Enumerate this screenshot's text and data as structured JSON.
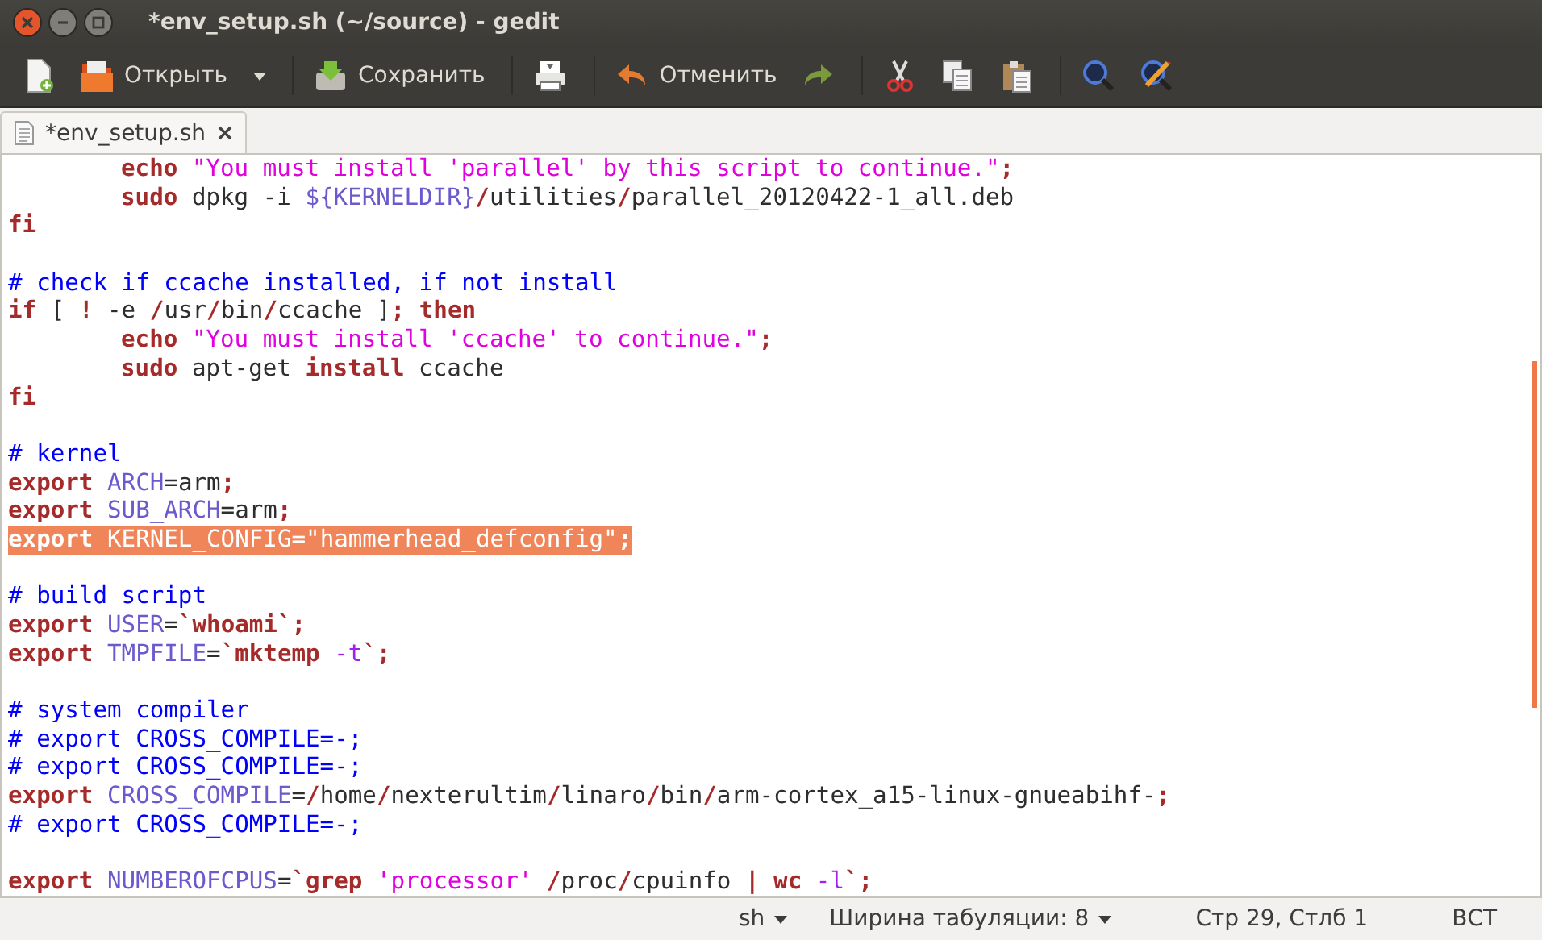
{
  "window": {
    "title": "*env_setup.sh (~/source) - gedit"
  },
  "toolbar": {
    "items": [
      {
        "kind": "new"
      },
      {
        "kind": "open",
        "label": "Открыть",
        "dropdown": true
      },
      {
        "kind": "separator"
      },
      {
        "kind": "save",
        "label": "Сохранить"
      },
      {
        "kind": "separator"
      },
      {
        "kind": "print"
      },
      {
        "kind": "separator"
      },
      {
        "kind": "undo",
        "label": "Отменить"
      },
      {
        "kind": "redo"
      },
      {
        "kind": "separator"
      },
      {
        "kind": "cut"
      },
      {
        "kind": "copy"
      },
      {
        "kind": "paste"
      },
      {
        "kind": "separator"
      },
      {
        "kind": "find"
      },
      {
        "kind": "replace"
      }
    ]
  },
  "tabs": [
    {
      "label": "*env_setup.sh",
      "selected": true
    }
  ],
  "editor": {
    "lines": [
      {
        "selected": false,
        "indent": true,
        "tokens": [
          {
            "kind": "kw",
            "text": "echo"
          },
          {
            "kind": "str",
            "text": " \"You must install 'parallel' by this script to continue.\""
          },
          {
            "kind": "op",
            "text": ";"
          }
        ]
      },
      {
        "selected": false,
        "indent": true,
        "tokens": [
          {
            "kind": "kw",
            "text": "sudo"
          },
          {
            "kind": "pl",
            "text": " dpkg -i "
          },
          {
            "kind": "var",
            "text": "${KERNELDIR}"
          },
          {
            "kind": "op",
            "text": "/"
          },
          {
            "kind": "pl",
            "text": "utilities"
          },
          {
            "kind": "op",
            "text": "/"
          },
          {
            "kind": "pl",
            "text": "parallel_20120422-1_all.deb"
          }
        ]
      },
      {
        "selected": false,
        "tokens": [
          {
            "kind": "kw",
            "text": "fi"
          }
        ]
      },
      {
        "selected": false
      },
      {
        "selected": false,
        "tokens": [
          {
            "kind": "cm",
            "text": "# check if ccache installed, if not install"
          }
        ]
      },
      {
        "selected": false,
        "tokens": [
          {
            "kind": "kw",
            "text": "if"
          },
          {
            "kind": "pl",
            "text": " [ "
          },
          {
            "kind": "kw",
            "text": "!"
          },
          {
            "kind": "pl",
            "text": " -e "
          },
          {
            "kind": "op",
            "text": "/"
          },
          {
            "kind": "pl",
            "text": "usr"
          },
          {
            "kind": "op",
            "text": "/"
          },
          {
            "kind": "pl",
            "text": "bin"
          },
          {
            "kind": "op",
            "text": "/"
          },
          {
            "kind": "pl",
            "text": "ccache ]"
          },
          {
            "kind": "op",
            "text": ";"
          },
          {
            "kind": "kw",
            "text": " then"
          }
        ]
      },
      {
        "selected": false,
        "indent": true,
        "tokens": [
          {
            "kind": "kw",
            "text": "echo"
          },
          {
            "kind": "str",
            "text": " \"You must install 'ccache' to continue.\""
          },
          {
            "kind": "op",
            "text": ";"
          }
        ]
      },
      {
        "selected": false,
        "indent": true,
        "tokens": [
          {
            "kind": "kw",
            "text": "sudo"
          },
          {
            "kind": "pl",
            "text": " apt-get "
          },
          {
            "kind": "kw",
            "text": "install"
          },
          {
            "kind": "pl",
            "text": " ccache"
          }
        ]
      },
      {
        "selected": false,
        "tokens": [
          {
            "kind": "kw",
            "text": "fi"
          }
        ]
      },
      {
        "selected": false
      },
      {
        "selected": false,
        "tokens": [
          {
            "kind": "cm",
            "text": "# kernel"
          }
        ]
      },
      {
        "selected": false,
        "tokens": [
          {
            "kind": "kw",
            "text": "export"
          },
          {
            "kind": "var",
            "text": " ARCH"
          },
          {
            "kind": "pl",
            "text": "=arm"
          },
          {
            "kind": "op",
            "text": ";"
          }
        ]
      },
      {
        "selected": false,
        "tokens": [
          {
            "kind": "kw",
            "text": "export"
          },
          {
            "kind": "var",
            "text": " SUB_ARCH"
          },
          {
            "kind": "pl",
            "text": "=arm"
          },
          {
            "kind": "op",
            "text": ";"
          }
        ]
      },
      {
        "selected": true,
        "tokens": [
          {
            "kind": "kw",
            "text": "export"
          },
          {
            "kind": "var",
            "text": " KERNEL_CONFIG"
          },
          {
            "kind": "pl",
            "text": "="
          },
          {
            "kind": "str",
            "text": "\"hammerhead_defconfig\""
          },
          {
            "kind": "op",
            "text": ";"
          }
        ]
      },
      {
        "selected": false
      },
      {
        "selected": false,
        "tokens": [
          {
            "kind": "cm",
            "text": "# build script"
          }
        ]
      },
      {
        "selected": false,
        "tokens": [
          {
            "kind": "kw",
            "text": "export"
          },
          {
            "kind": "var",
            "text": " USER"
          },
          {
            "kind": "pl",
            "text": "="
          },
          {
            "kind": "op",
            "text": "`"
          },
          {
            "kind": "kw",
            "text": "whoami"
          },
          {
            "kind": "op",
            "text": "`;"
          }
        ]
      },
      {
        "selected": false,
        "tokens": [
          {
            "kind": "kw",
            "text": "export"
          },
          {
            "kind": "var",
            "text": " TMPFILE"
          },
          {
            "kind": "pl",
            "text": "="
          },
          {
            "kind": "op",
            "text": "`"
          },
          {
            "kind": "kw",
            "text": "mktemp"
          },
          {
            "kind": "opt",
            "text": " -t"
          },
          {
            "kind": "op",
            "text": "`;"
          }
        ]
      },
      {
        "selected": false
      },
      {
        "selected": false,
        "tokens": [
          {
            "kind": "cm",
            "text": "# system compiler"
          }
        ]
      },
      {
        "selected": false,
        "tokens": [
          {
            "kind": "cm",
            "text": "# export CROSS_COMPILE=-;"
          }
        ]
      },
      {
        "selected": false,
        "tokens": [
          {
            "kind": "cm",
            "text": "# export CROSS_COMPILE=-;"
          }
        ]
      },
      {
        "selected": false,
        "tokens": [
          {
            "kind": "kw",
            "text": "export"
          },
          {
            "kind": "var",
            "text": " CROSS_COMPILE"
          },
          {
            "kind": "pl",
            "text": "="
          },
          {
            "kind": "op",
            "text": "/"
          },
          {
            "kind": "pl",
            "text": "home"
          },
          {
            "kind": "op",
            "text": "/"
          },
          {
            "kind": "pl",
            "text": "nexterultim"
          },
          {
            "kind": "op",
            "text": "/"
          },
          {
            "kind": "pl",
            "text": "linaro"
          },
          {
            "kind": "op",
            "text": "/"
          },
          {
            "kind": "pl",
            "text": "bin"
          },
          {
            "kind": "op",
            "text": "/"
          },
          {
            "kind": "pl",
            "text": "arm-cortex_a15-linux-gnueabihf-"
          },
          {
            "kind": "op",
            "text": ";"
          }
        ]
      },
      {
        "selected": false,
        "tokens": [
          {
            "kind": "cm",
            "text": "# export CROSS_COMPILE=-;"
          }
        ]
      },
      {
        "selected": false
      },
      {
        "selected": false,
        "tokens": [
          {
            "kind": "kw",
            "text": "export"
          },
          {
            "kind": "var",
            "text": " NUMBEROFCPUS"
          },
          {
            "kind": "pl",
            "text": "="
          },
          {
            "kind": "op",
            "text": "`"
          },
          {
            "kind": "kw",
            "text": "grep"
          },
          {
            "kind": "str",
            "text": " 'processor'"
          },
          {
            "kind": "op",
            "text": " /"
          },
          {
            "kind": "pl",
            "text": "proc"
          },
          {
            "kind": "op",
            "text": "/"
          },
          {
            "kind": "pl",
            "text": "cpuinfo "
          },
          {
            "kind": "op",
            "text": "|"
          },
          {
            "kind": "kw",
            "text": " wc"
          },
          {
            "kind": "opt",
            "text": " -l"
          },
          {
            "kind": "op",
            "text": "`;"
          }
        ]
      }
    ]
  },
  "status_bar": {
    "items": [
      {
        "kind": "dropdown",
        "label": "sh"
      },
      {
        "kind": "dropdown",
        "label": "Ширина табуляции: 8"
      },
      {
        "kind": "text",
        "label": "Стр 29, Стлб 1"
      },
      {
        "kind": "text",
        "label": "ВСТ"
      }
    ]
  }
}
